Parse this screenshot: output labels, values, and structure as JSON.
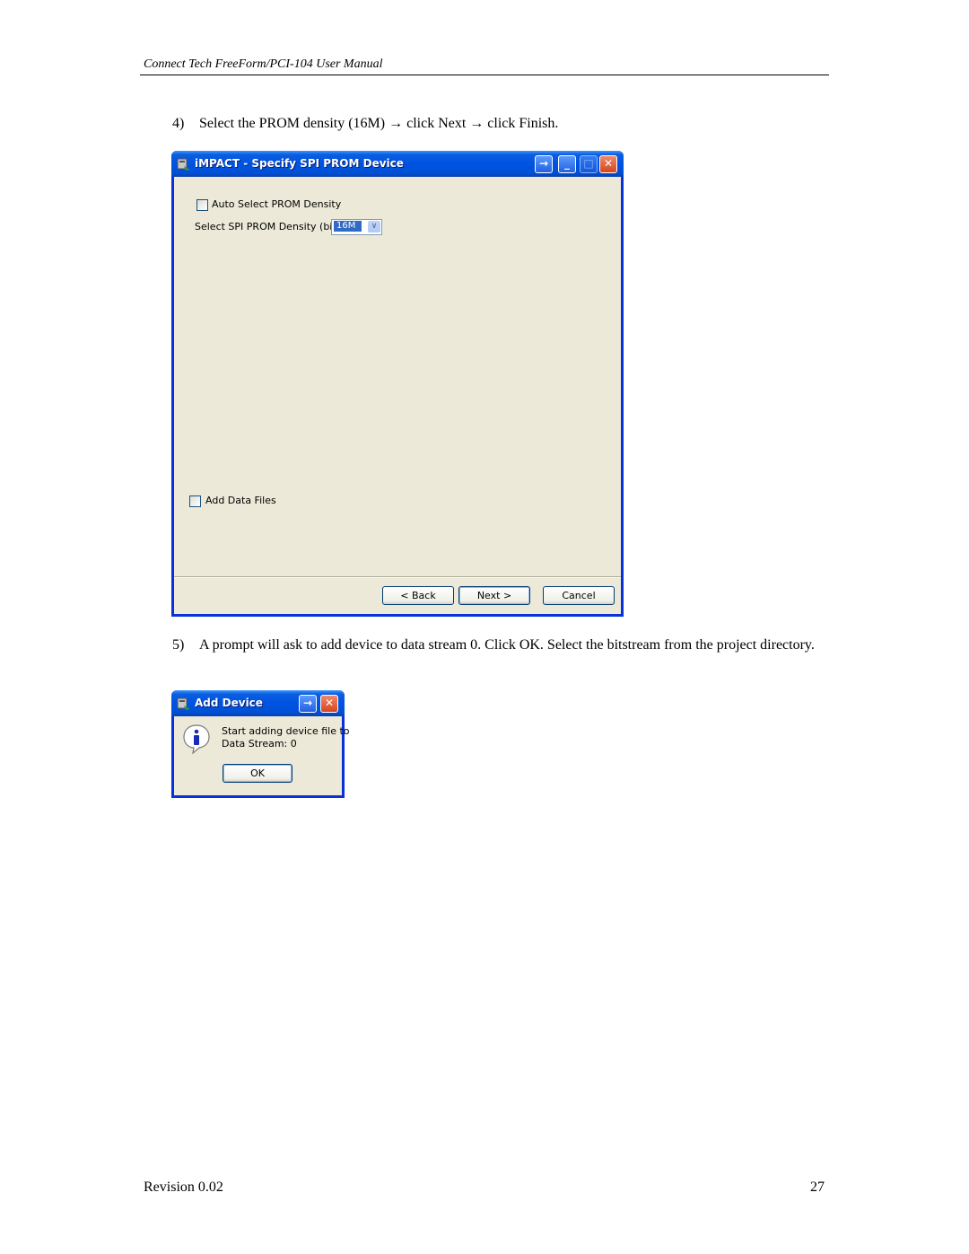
{
  "header": {
    "title": "Connect Tech FreeForm/PCI-104 User Manual"
  },
  "steps": [
    {
      "number": "4)",
      "text": "Select the PROM density (16M) →  click Next → click Finish."
    },
    {
      "number": "5)",
      "text": "A prompt will ask to add device to data stream 0. Click OK.  Select the bitstream from the project directory."
    }
  ],
  "spi_dialog": {
    "title": "iMPACT - Specify SPI PROM Device",
    "auto_select_label": "Auto Select PROM Density",
    "auto_select_checked": false,
    "density_label": "Select SPI PROM Density (bits)",
    "density_value": "16M",
    "add_data_files_label": "Add Data Files",
    "add_data_files_checked": false,
    "buttons": {
      "back": "< Back",
      "next": "Next >",
      "cancel": "Cancel"
    }
  },
  "add_device_dialog": {
    "title": "Add Device",
    "message_line1": "Start adding device file to",
    "message_line2": "Data Stream: 0",
    "ok": "OK"
  },
  "footer": {
    "revision": "Revision 0.02",
    "page": "27"
  },
  "icons": {
    "window_icon": "impact-app-icon",
    "info": "info-icon",
    "context_help": "context-help-icon",
    "minimize": "minimize-icon",
    "maximize": "maximize-icon",
    "close": "close-icon"
  }
}
